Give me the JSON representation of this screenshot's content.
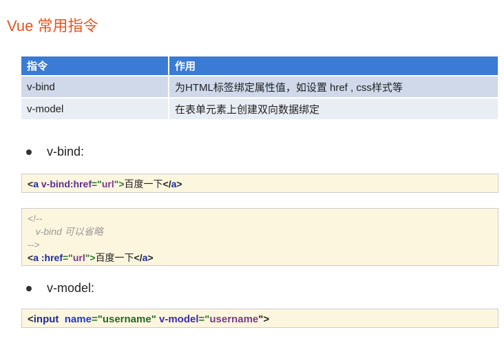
{
  "title": "Vue 常用指令",
  "table": {
    "headers": [
      "指令",
      "作用"
    ],
    "rows": [
      [
        "v-bind",
        "为HTML标签绑定属性值，如设置 href , css样式等"
      ],
      [
        "v-model",
        "在表单元素上创建双向数据绑定"
      ]
    ]
  },
  "bullets": [
    "v-bind:",
    "v-model:"
  ],
  "code1": [
    {
      "t": "<",
      "c": "#222"
    },
    {
      "t": "a ",
      "c": "#1a2aa0"
    },
    {
      "t": "v-bind:href",
      "c": "#5b2d8e"
    },
    {
      "t": "=\"",
      "c": "#2a7a2a"
    },
    {
      "t": "url",
      "c": "#7a3a8a"
    },
    {
      "t": "\">",
      "c": "#2a7a2a"
    },
    {
      "t": "百度一下",
      "c": "#222",
      "n": 1
    },
    {
      "t": "</",
      "c": "#222"
    },
    {
      "t": "a",
      "c": "#1a2aa0"
    },
    {
      "t": ">",
      "c": "#222"
    }
  ],
  "code2_comment": [
    "<!--",
    "   v-bind 可以省略",
    "-->"
  ],
  "code2": [
    {
      "t": "<",
      "c": "#222"
    },
    {
      "t": "a ",
      "c": "#1a2aa0"
    },
    {
      "t": ":href",
      "c": "#1a2aa0"
    },
    {
      "t": "=\"",
      "c": "#2a7a2a"
    },
    {
      "t": "url",
      "c": "#7a3a8a"
    },
    {
      "t": "\">",
      "c": "#2a7a2a"
    },
    {
      "t": "百度一下",
      "c": "#222",
      "n": 1
    },
    {
      "t": "</",
      "c": "#222"
    },
    {
      "t": "a",
      "c": "#1a2aa0"
    },
    {
      "t": ">",
      "c": "#222"
    }
  ],
  "code3": [
    {
      "t": "<",
      "c": "#222"
    },
    {
      "t": "input  ",
      "c": "#1a2aa0"
    },
    {
      "t": "name",
      "c": "#1a3ad0"
    },
    {
      "t": "=",
      "c": "#2a7a2a"
    },
    {
      "t": "\"username\" ",
      "c": "#1f6a2a"
    },
    {
      "t": "v-model",
      "c": "#3a2ab0"
    },
    {
      "t": "=\"",
      "c": "#2a7a2a"
    },
    {
      "t": "username",
      "c": "#7a3a8a"
    },
    {
      "t": "\">",
      "c": "#222"
    }
  ]
}
